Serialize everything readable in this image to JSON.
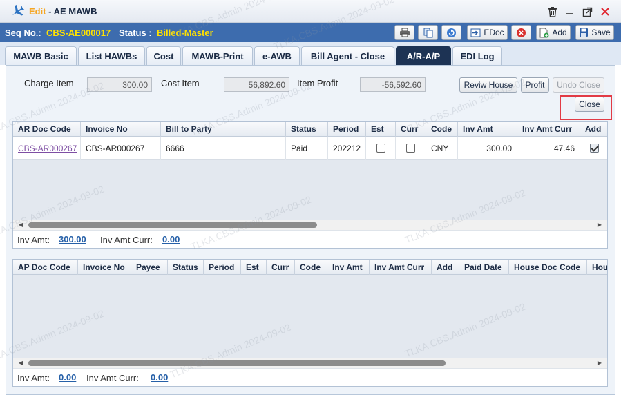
{
  "window": {
    "edit_label": "Edit",
    "title": " - AE MAWB",
    "watermark": "TLKA.CBS.Admin 2024-09-02"
  },
  "infobar": {
    "seq_label": "Seq No.:",
    "seq_value": "CBS-AE000017",
    "status_label": "Status :",
    "status_value": "Billed-Master",
    "edoc_label": "EDoc",
    "add_label": "Add",
    "save_label": "Save"
  },
  "tabs": [
    {
      "label": "MAWB Basic"
    },
    {
      "label": "List HAWBs"
    },
    {
      "label": "Cost"
    },
    {
      "label": "MAWB-Print"
    },
    {
      "label": "e-AWB"
    },
    {
      "label": "Bill Agent - Close"
    },
    {
      "label": "A/R-A/P"
    },
    {
      "label": "EDI Log"
    }
  ],
  "summary": {
    "charge_label": "Charge Item",
    "charge_value": "300.00",
    "cost_label": "Cost Item",
    "cost_value": "56,892.60",
    "profit_label": "Item Profit",
    "profit_value": "-56,592.60",
    "review_house_label": "Reviw House",
    "profit_button_label": "Profit",
    "undo_close_label": "Undo Close",
    "close_label": "Close"
  },
  "ar_grid": {
    "columns": [
      "AR Doc Code",
      "Invoice No",
      "Bill to Party",
      "Status",
      "Period",
      "Est",
      "Curr",
      "Code",
      "Inv Amt",
      "Inv Amt Curr",
      "Add"
    ],
    "rows": [
      {
        "doc_code": "CBS-AR000267",
        "invoice_no": "CBS-AR000267",
        "bill_to": "6666",
        "status": "Paid",
        "period": "202212",
        "est": false,
        "curr": false,
        "code": "CNY",
        "inv_amt": "300.00",
        "inv_amt_curr": "47.46",
        "add": true
      }
    ],
    "footer": {
      "inv_amt_label": "Inv Amt:",
      "inv_amt": "300.00",
      "inv_amt_curr_label": "Inv Amt Curr:",
      "inv_amt_curr": "0.00"
    }
  },
  "ap_grid": {
    "columns": [
      "AP Doc Code",
      "Invoice No",
      "Payee",
      "Status",
      "Period",
      "Est",
      "Curr",
      "Code",
      "Inv Amt",
      "Inv Amt Curr",
      "Add",
      "Paid Date",
      "House Doc Code",
      "Hou"
    ],
    "rows": [],
    "footer": {
      "inv_amt_label": "Inv Amt:",
      "inv_amt": "0.00",
      "inv_amt_curr_label": "Inv Amt Curr:",
      "inv_amt_curr": "0.00"
    }
  },
  "colors": {
    "accent": "#3d6cae",
    "status_yellow": "#ffe200",
    "active_tab": "#1d3354",
    "highlight_red": "#e23b45"
  }
}
